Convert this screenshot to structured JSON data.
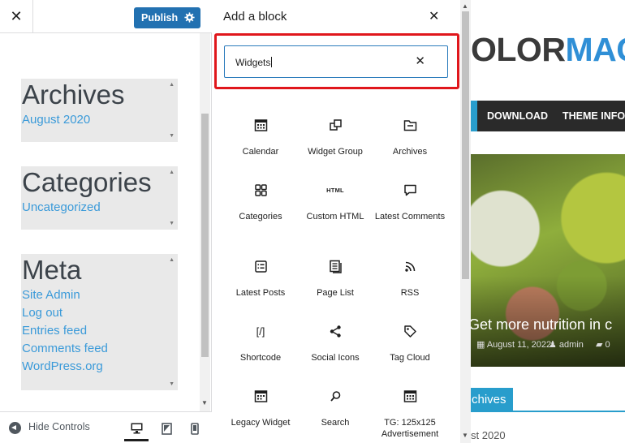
{
  "customizer": {
    "close_glyph": "✕",
    "publish_label": "Publish",
    "footer": {
      "hide_controls_label": "Hide Controls"
    }
  },
  "preview_widgets": [
    {
      "title": "Archives",
      "links": [
        "August 2020"
      ]
    },
    {
      "title": "Categories",
      "links": [
        "Uncategorized"
      ]
    },
    {
      "title": "Meta",
      "links": [
        "Site Admin",
        "Log out",
        "Entries feed",
        "Comments feed",
        "WordPress.org"
      ]
    }
  ],
  "inserter": {
    "title": "Add a block",
    "close_glyph": "✕",
    "search_value": "Widgets",
    "clear_glyph": "✕",
    "blocks": [
      {
        "label": "Calendar",
        "icon": "calendar-icon"
      },
      {
        "label": "Widget Group",
        "icon": "widget-group-icon"
      },
      {
        "label": "Archives",
        "icon": "archives-icon"
      },
      {
        "label": "Categories",
        "icon": "categories-icon"
      },
      {
        "label": "Custom HTML",
        "icon": "html-icon",
        "icon_text": "HTML"
      },
      {
        "label": "Latest Comments",
        "icon": "comment-icon"
      },
      {
        "label": "Latest Posts",
        "icon": "latest-posts-icon"
      },
      {
        "label": "Page List",
        "icon": "page-list-icon"
      },
      {
        "label": "RSS",
        "icon": "rss-icon"
      },
      {
        "label": "Shortcode",
        "icon": "shortcode-icon",
        "icon_text": "[/]"
      },
      {
        "label": "Social Icons",
        "icon": "share-icon"
      },
      {
        "label": "Tag Cloud",
        "icon": "tag-icon"
      },
      {
        "label": "Legacy Widget",
        "icon": "legacy-widget-icon"
      },
      {
        "label": "Search",
        "icon": "search-icon"
      },
      {
        "label": "TG: 125x125 Advertisement",
        "icon": "advertisement-icon"
      }
    ]
  },
  "site_preview": {
    "logo_part1": "OLOR",
    "logo_part2": "MAG",
    "nav": [
      "DOWNLOAD",
      "THEME INFO"
    ],
    "hero_title": "Get more nutrition in c",
    "hero_date": "August 11, 2022",
    "hero_author": "admin",
    "hero_comments": "0",
    "archives_tab": "chives",
    "archives_month": "st 2020"
  },
  "colors": {
    "publish": "#2271b1",
    "highlight": "#e0171c",
    "link": "#3a9ad9",
    "theme_accent": "#289dcc"
  }
}
